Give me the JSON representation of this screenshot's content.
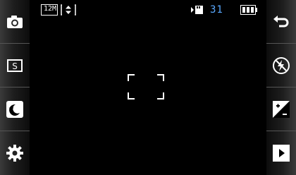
{
  "status": {
    "resolution": "12M",
    "shots_remaining": "31"
  },
  "left_toolbar": [
    {
      "name": "camera-mode-icon"
    },
    {
      "name": "scene-mode-icon"
    },
    {
      "name": "night-mode-icon"
    },
    {
      "name": "settings-gear-icon"
    }
  ],
  "right_toolbar": [
    {
      "name": "back-icon"
    },
    {
      "name": "flash-off-icon"
    },
    {
      "name": "exposure-compensation-icon"
    },
    {
      "name": "gallery-play-icon"
    }
  ],
  "colors": {
    "accent_blue": "#5aa9ff",
    "icon_white": "#ffffff"
  }
}
